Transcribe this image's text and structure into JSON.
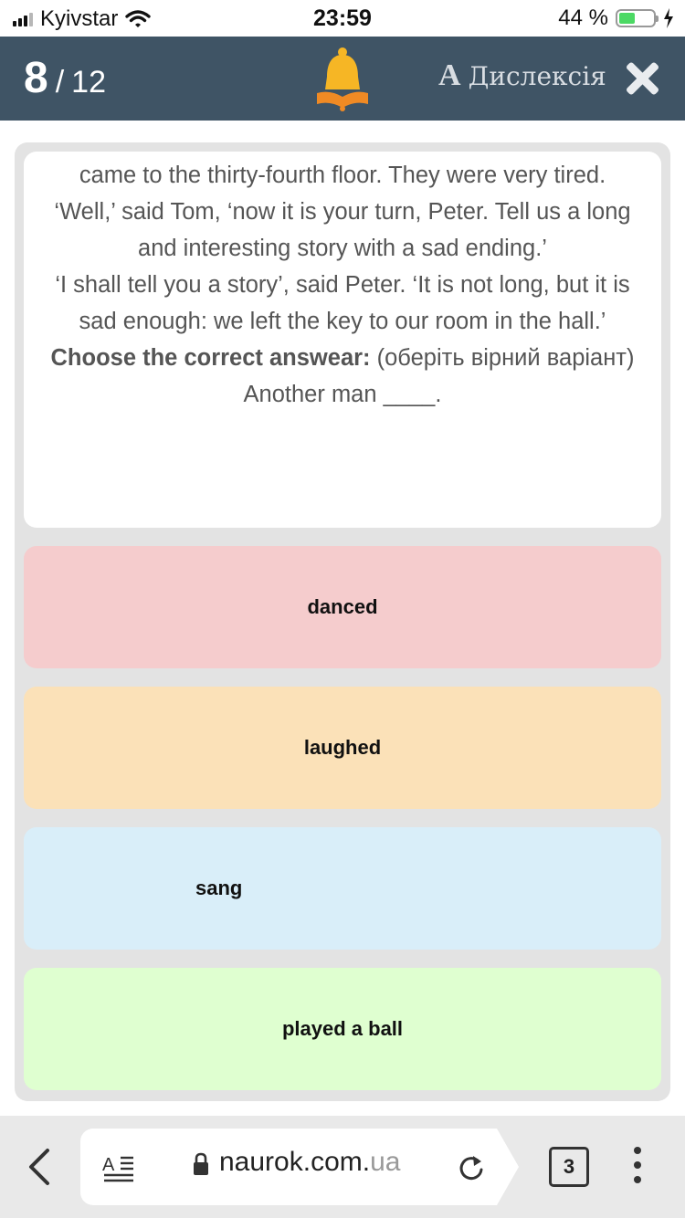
{
  "status_bar": {
    "carrier": "Kyivstar",
    "time": "23:59",
    "battery_percent": "44 %",
    "battery_level": 0.44
  },
  "header": {
    "current": "8",
    "separator": "/",
    "total": "12",
    "dyslexia_icon": "A",
    "dyslexia_label": "Дислексія"
  },
  "question": {
    "lines": [
      "came to the thirty-fourth floor. They were very tired.",
      "‘Well,’ said Tom, ‘now it is your turn, Peter. Tell us a long and interesting story with a sad ending.’",
      "‘I shall tell you a story’, said Peter. ‘It is not long, but it is sad enough: we left the key to our room in the hall.’"
    ],
    "instruction_bold": "Choose the correct answear:",
    "instruction_rest": " (оберіть вірний варіант)",
    "prompt": "Another man ____."
  },
  "answers": [
    {
      "label": "danced",
      "color": "#f5cccd"
    },
    {
      "label": "laughed",
      "color": "#fbe1b8"
    },
    {
      "label": "sang",
      "color": "#d9eef9"
    },
    {
      "label": "played a ball",
      "color": "#dfffd0"
    }
  ],
  "browser": {
    "url_domain": "naurok.com.",
    "url_tld": "ua",
    "tab_count": "3"
  },
  "colors": {
    "header_bg": "#3f5465",
    "bell": "#f6b625",
    "book": "#f08a24"
  }
}
